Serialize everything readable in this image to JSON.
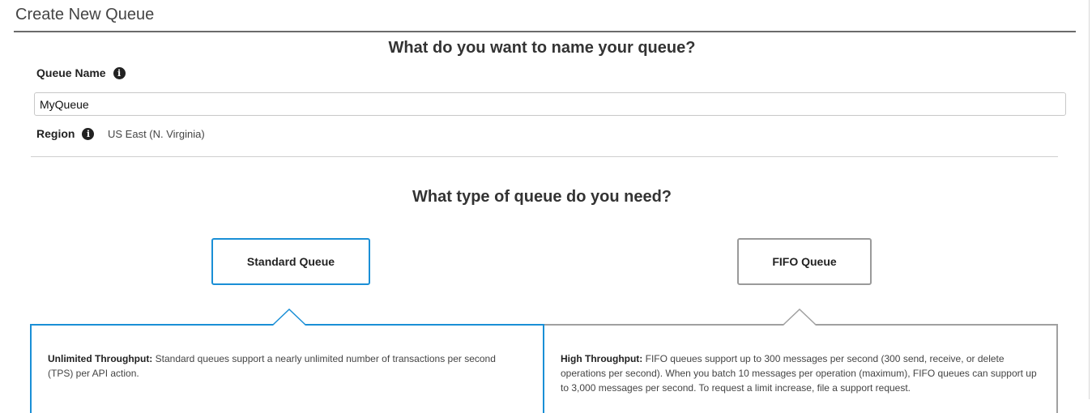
{
  "header": {
    "title": "Create New Queue"
  },
  "name_section": {
    "heading": "What do you want to name your queue?",
    "queue_name_label": "Queue Name",
    "queue_name_value": "MyQueue",
    "region_label": "Region",
    "region_value": "US East (N. Virginia)"
  },
  "type_section": {
    "heading": "What type of queue do you need?",
    "options": [
      {
        "label": "Standard Queue",
        "selected": true,
        "desc_title": "Unlimited Throughput:",
        "desc_body": " Standard queues support a nearly unlimited number of transactions per second (TPS) per API action."
      },
      {
        "label": "FIFO Queue",
        "selected": false,
        "desc_title": "High Throughput:",
        "desc_body": " FIFO queues support up to 300 messages per second (300 send, receive, or delete operations per second). When you batch 10 messages per operation (maximum), FIFO queues can support up to 3,000 messages per second. To request a limit increase, file a support request."
      }
    ]
  },
  "icons": {
    "info": "info-circle-icon"
  },
  "colors": {
    "selected_border": "#1a8fd6",
    "unselected_border": "#9a9a9a"
  }
}
